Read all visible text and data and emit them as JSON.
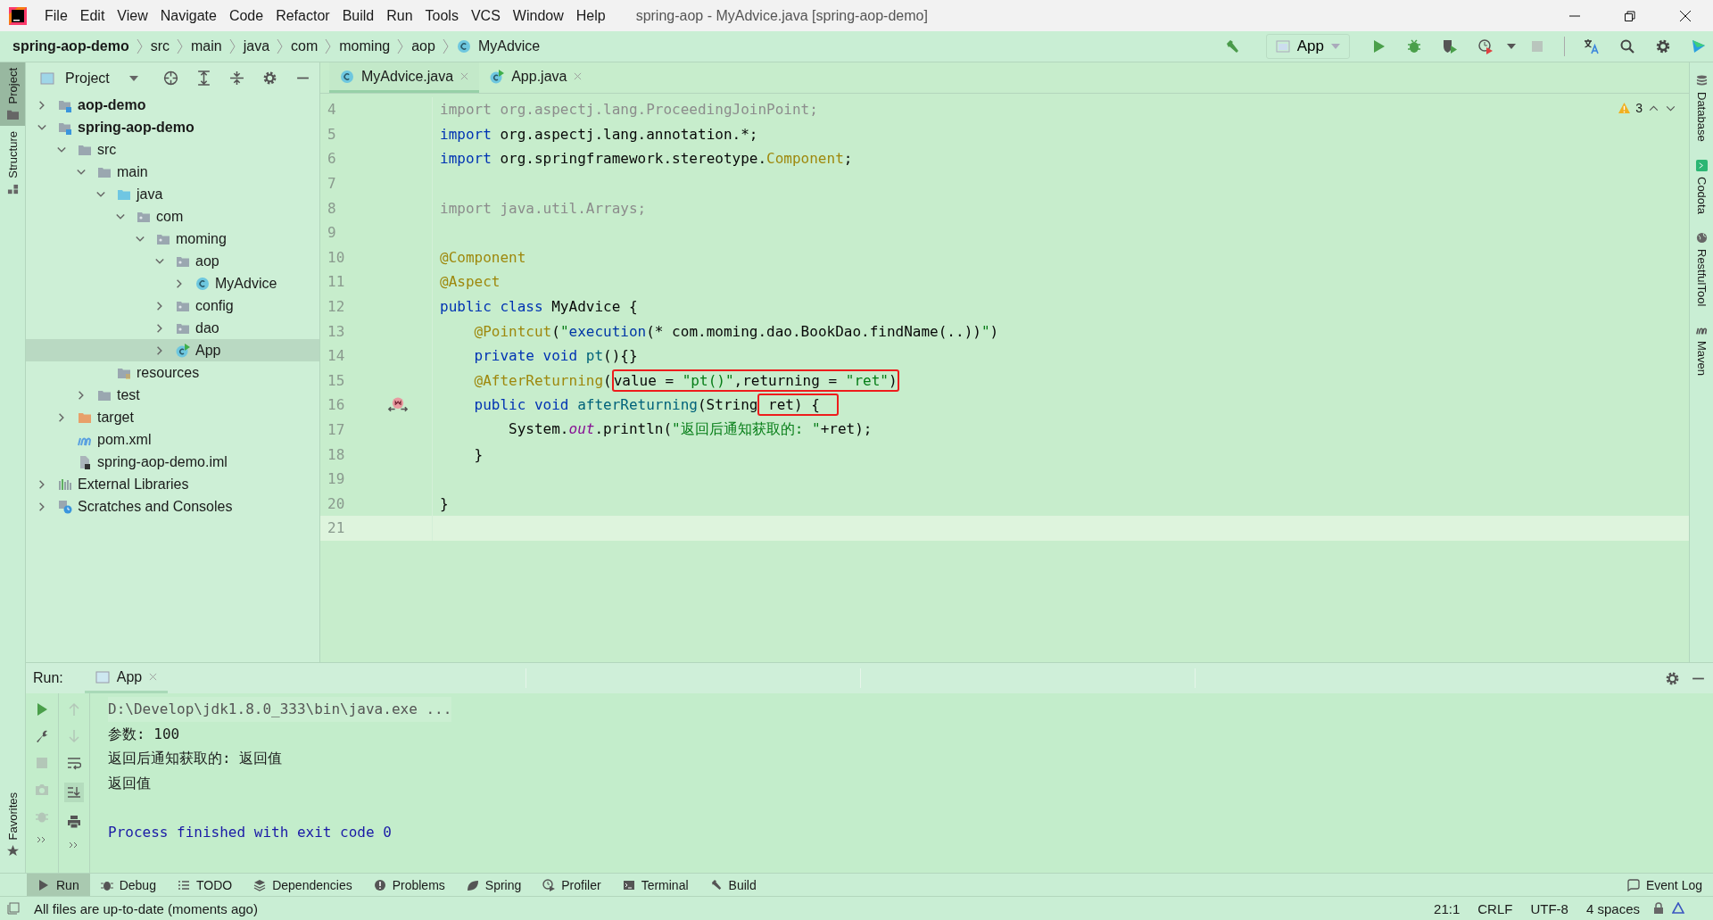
{
  "window": {
    "title": "spring-aop - MyAdvice.java [spring-aop-demo]"
  },
  "menu": [
    "File",
    "Edit",
    "View",
    "Navigate",
    "Code",
    "Refactor",
    "Build",
    "Run",
    "Tools",
    "VCS",
    "Window",
    "Help"
  ],
  "breadcrumbs": [
    {
      "label": "spring-aop-demo",
      "kind": "project"
    },
    {
      "label": "src",
      "kind": "dir"
    },
    {
      "label": "main",
      "kind": "dir"
    },
    {
      "label": "java",
      "kind": "dir"
    },
    {
      "label": "com",
      "kind": "dir"
    },
    {
      "label": "moming",
      "kind": "dir"
    },
    {
      "label": "aop",
      "kind": "dir"
    },
    {
      "label": "MyAdvice",
      "kind": "class"
    }
  ],
  "run_config": {
    "label": "App"
  },
  "side_tabs_left": [
    {
      "label": "Project",
      "selected": true
    },
    {
      "label": "Structure",
      "selected": false
    }
  ],
  "favorites": {
    "label": "Favorites"
  },
  "side_tabs_right": [
    {
      "label": "Database",
      "kind": "database"
    },
    {
      "label": "Codota",
      "kind": "codota"
    },
    {
      "label": "RestfulTool",
      "kind": "globe"
    },
    {
      "label": "Maven",
      "kind": "maven"
    }
  ],
  "project_panel": {
    "title": "Project",
    "tree": [
      {
        "label": "aop-demo",
        "kind": "module",
        "bold": true,
        "expanded": false,
        "selected": false
      },
      {
        "label": "spring-aop-demo",
        "kind": "module",
        "bold": true,
        "expanded": true,
        "selected": false,
        "children": [
          {
            "label": "src",
            "kind": "folder",
            "bold": false,
            "expanded": true,
            "selected": false,
            "children": [
              {
                "label": "main",
                "kind": "folder",
                "bold": false,
                "expanded": true,
                "selected": false,
                "children": [
                  {
                    "label": "java",
                    "kind": "source",
                    "bold": false,
                    "expanded": true,
                    "selected": false,
                    "children": [
                      {
                        "label": "com",
                        "kind": "package",
                        "bold": false,
                        "expanded": true,
                        "selected": false,
                        "children": [
                          {
                            "label": "moming",
                            "kind": "package",
                            "bold": false,
                            "expanded": true,
                            "selected": false,
                            "children": [
                              {
                                "label": "aop",
                                "kind": "package",
                                "bold": false,
                                "expanded": true,
                                "selected": false,
                                "children": [
                                  {
                                    "label": "MyAdvice",
                                    "kind": "class",
                                    "bold": false,
                                    "expanded": false,
                                    "selected": false
                                  }
                                ]
                              },
                              {
                                "label": "config",
                                "kind": "package",
                                "bold": false,
                                "expanded": false,
                                "selected": false
                              },
                              {
                                "label": "dao",
                                "kind": "package",
                                "bold": false,
                                "expanded": false,
                                "selected": false
                              },
                              {
                                "label": "App",
                                "kind": "app",
                                "bold": false,
                                "expanded": false,
                                "selected": true
                              }
                            ]
                          }
                        ]
                      }
                    ]
                  },
                  {
                    "label": "resources",
                    "kind": "resources",
                    "bold": false,
                    "selected": false
                  }
                ]
              },
              {
                "label": "test",
                "kind": "folder",
                "bold": false,
                "expanded": false,
                "selected": false
              }
            ]
          },
          {
            "label": "target",
            "kind": "excluded",
            "bold": false,
            "expanded": false,
            "selected": false
          },
          {
            "label": "pom.xml",
            "kind": "maven",
            "bold": false,
            "selected": false
          },
          {
            "label": "spring-aop-demo.iml",
            "kind": "iml",
            "bold": false,
            "selected": false
          }
        ]
      },
      {
        "label": "External Libraries",
        "kind": "libraries",
        "bold": false,
        "expanded": false,
        "selected": false
      },
      {
        "label": "Scratches and Consoles",
        "kind": "scratches",
        "bold": false,
        "expanded": false,
        "selected": false
      }
    ]
  },
  "editor": {
    "tabs": [
      {
        "label": "MyAdvice.java",
        "kind": "class",
        "selected": true
      },
      {
        "label": "App.java",
        "kind": "app",
        "selected": false
      }
    ],
    "warnings": "3",
    "lines": [
      {
        "number": "4",
        "current": false,
        "advice_marker": false,
        "segments": [
          {
            "kind": "gray",
            "text": "import org.aspectj.lang.ProceedingJoinPoint;"
          }
        ]
      },
      {
        "number": "5",
        "current": false,
        "advice_marker": false,
        "segments": [
          {
            "kind": "kw",
            "text": "import "
          },
          {
            "kind": "plain",
            "text": "org.aspectj.lang.annotation.*;"
          }
        ]
      },
      {
        "number": "6",
        "current": false,
        "advice_marker": false,
        "segments": [
          {
            "kind": "kw",
            "text": "import "
          },
          {
            "kind": "plain",
            "text": "org.springframework.stereotype."
          },
          {
            "kind": "ann",
            "text": "Component"
          },
          {
            "kind": "plain",
            "text": ";"
          }
        ]
      },
      {
        "number": "7",
        "current": false,
        "advice_marker": false
      },
      {
        "number": "8",
        "current": false,
        "advice_marker": false,
        "segments": [
          {
            "kind": "gray",
            "text": "import java.util.Arrays;"
          }
        ]
      },
      {
        "number": "9",
        "current": false,
        "advice_marker": false
      },
      {
        "number": "10",
        "current": false,
        "advice_marker": false,
        "segments": [
          {
            "kind": "ann",
            "text": "@Component"
          }
        ]
      },
      {
        "number": "11",
        "current": false,
        "advice_marker": false,
        "segments": [
          {
            "kind": "ann",
            "text": "@Aspect"
          }
        ]
      },
      {
        "number": "12",
        "current": false,
        "advice_marker": false,
        "segments": [
          {
            "kind": "kw",
            "text": "public class "
          },
          {
            "kind": "plain",
            "text": "MyAdvice {"
          }
        ]
      },
      {
        "number": "13",
        "current": false,
        "advice_marker": false,
        "segments": [
          {
            "kind": "ann",
            "text": "    @Pointcut"
          },
          {
            "kind": "plain",
            "text": "("
          },
          {
            "kind": "str",
            "text": "\""
          },
          {
            "kind": "inj",
            "text": "execution"
          },
          {
            "kind": "plain",
            "text": "(* com.moming.dao.BookDao.findName(..))"
          },
          {
            "kind": "str",
            "text": "\""
          },
          {
            "kind": "plain",
            "text": ")"
          }
        ]
      },
      {
        "number": "14",
        "current": false,
        "advice_marker": false,
        "segments": [
          {
            "kind": "kw",
            "text": "    private void "
          },
          {
            "kind": "decl",
            "text": "pt"
          },
          {
            "kind": "plain",
            "text": "(){}"
          }
        ]
      },
      {
        "number": "15",
        "current": false,
        "advice_marker": false,
        "segments": [
          {
            "kind": "ann",
            "text": "    @AfterReturning"
          },
          {
            "kind": "plain",
            "text": "("
          },
          {
            "kind": "box",
            "segments": [
              {
                "kind": "plain",
                "text": "value = "
              },
              {
                "kind": "str",
                "text": "\"pt()\""
              },
              {
                "kind": "plain",
                "text": ",returning = "
              },
              {
                "kind": "str",
                "text": "\"ret\""
              },
              {
                "kind": "plain",
                "text": ")"
              }
            ]
          }
        ]
      },
      {
        "number": "16",
        "current": false,
        "advice_marker": true,
        "segments": [
          {
            "kind": "kw",
            "text": "    public void "
          },
          {
            "kind": "decl",
            "text": "afterReturning"
          },
          {
            "kind": "plain",
            "text": "(String"
          },
          {
            "kind": "box",
            "segments": [
              {
                "kind": "plain",
                "text": " ret) {  "
              }
            ]
          }
        ]
      },
      {
        "number": "17",
        "current": false,
        "advice_marker": false,
        "segments": [
          {
            "kind": "plain",
            "text": "        System."
          },
          {
            "kind": "field",
            "text": "out"
          },
          {
            "kind": "plain",
            "text": ".println("
          },
          {
            "kind": "str",
            "text": "\"返回后通知获取的: \""
          },
          {
            "kind": "plain",
            "text": "+ret);"
          }
        ]
      },
      {
        "number": "18",
        "current": false,
        "advice_marker": false,
        "segments": [
          {
            "kind": "plain",
            "text": "    }"
          }
        ]
      },
      {
        "number": "19",
        "current": false,
        "advice_marker": false
      },
      {
        "number": "20",
        "current": false,
        "advice_marker": false,
        "segments": [
          {
            "kind": "plain",
            "text": "}"
          }
        ]
      },
      {
        "number": "21",
        "current": true,
        "advice_marker": false
      }
    ]
  },
  "run_panel": {
    "title": "Run:",
    "tab": "App",
    "console": [
      {
        "kind": "command",
        "text": "D:\\Develop\\jdk1.8.0_333\\bin\\java.exe ..."
      },
      {
        "kind": "output",
        "text": "参数: 100"
      },
      {
        "kind": "output",
        "text": "返回后通知获取的: 返回值"
      },
      {
        "kind": "output",
        "text": "返回值"
      },
      {
        "kind": "blank"
      },
      {
        "kind": "exit",
        "text": "Process finished with exit code 0"
      }
    ]
  },
  "tool_windows": [
    {
      "label": "Run",
      "kind": "run",
      "selected": true
    },
    {
      "label": "Debug",
      "kind": "debug",
      "selected": false
    },
    {
      "label": "TODO",
      "kind": "todo",
      "selected": false
    },
    {
      "label": "Dependencies",
      "kind": "layers",
      "selected": false
    },
    {
      "label": "Problems",
      "kind": "problems",
      "selected": false
    },
    {
      "label": "Spring",
      "kind": "spring",
      "selected": false
    },
    {
      "label": "Profiler",
      "kind": "profiler",
      "selected": false
    },
    {
      "label": "Terminal",
      "kind": "terminal",
      "selected": false
    },
    {
      "label": "Build",
      "kind": "build",
      "selected": false
    }
  ],
  "event_log": {
    "label": "Event Log"
  },
  "status": {
    "message": "All files are up-to-date (moments ago)",
    "position": "21:1",
    "line_separator": "CRLF",
    "encoding": "UTF-8",
    "indent": "4 spaces"
  }
}
